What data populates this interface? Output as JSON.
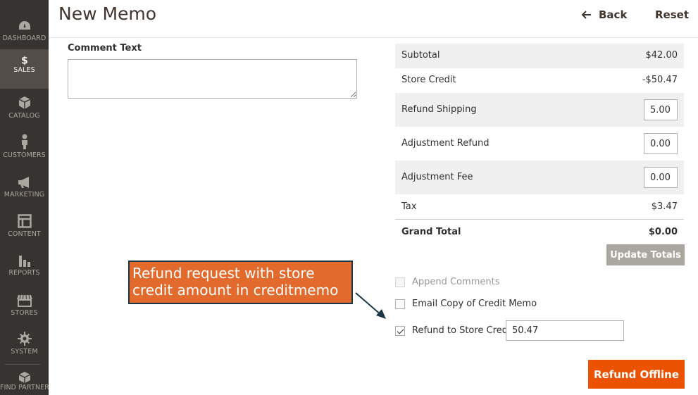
{
  "sidebar": {
    "items": [
      {
        "label": "DASHBOARD",
        "icon": "dashboard-icon"
      },
      {
        "label": "SALES",
        "icon": "dollar-icon",
        "active": true
      },
      {
        "label": "CATALOG",
        "icon": "cube-icon"
      },
      {
        "label": "CUSTOMERS",
        "icon": "person-icon"
      },
      {
        "label": "MARKETING",
        "icon": "megaphone-icon"
      },
      {
        "label": "CONTENT",
        "icon": "layout-icon"
      },
      {
        "label": "REPORTS",
        "icon": "bar-chart-icon"
      },
      {
        "label": "STORES",
        "icon": "storefront-icon"
      },
      {
        "label": "SYSTEM",
        "icon": "gear-icon"
      },
      {
        "label": "FIND PARTNERS",
        "icon": "boxes-icon"
      }
    ]
  },
  "header": {
    "title": "New Memo",
    "back_label": "Back",
    "reset_label": "Reset"
  },
  "comment": {
    "label": "Comment Text",
    "value": ""
  },
  "totals": {
    "subtotal_label": "Subtotal",
    "subtotal_value": "$42.00",
    "store_credit_label": "Store Credit",
    "store_credit_value": "-$50.47",
    "refund_shipping_label": "Refund Shipping",
    "refund_shipping_value": "5.00",
    "adjustment_refund_label": "Adjustment Refund",
    "adjustment_refund_value": "0.00",
    "adjustment_fee_label": "Adjustment Fee",
    "adjustment_fee_value": "0.00",
    "tax_label": "Tax",
    "tax_value": "$3.47",
    "grand_total_label": "Grand Total",
    "grand_total_value": "$0.00",
    "update_label": "Update Totals"
  },
  "options": {
    "append_comments_label": "Append Comments",
    "email_copy_label": "Email Copy of Credit Memo",
    "refund_store_credit_label": "Refund to Store Credit",
    "refund_store_credit_value": "50.47"
  },
  "actions": {
    "refund_offline_label": "Refund Offline"
  },
  "annotation": {
    "text": "Refund request with store credit amount in creditmemo"
  },
  "colors": {
    "sidebar_bg": "#373330",
    "sidebar_active": "#524d49",
    "primary_button": "#eb5202",
    "callout_bg": "#e16a2c",
    "callout_border": "#1c3747"
  }
}
